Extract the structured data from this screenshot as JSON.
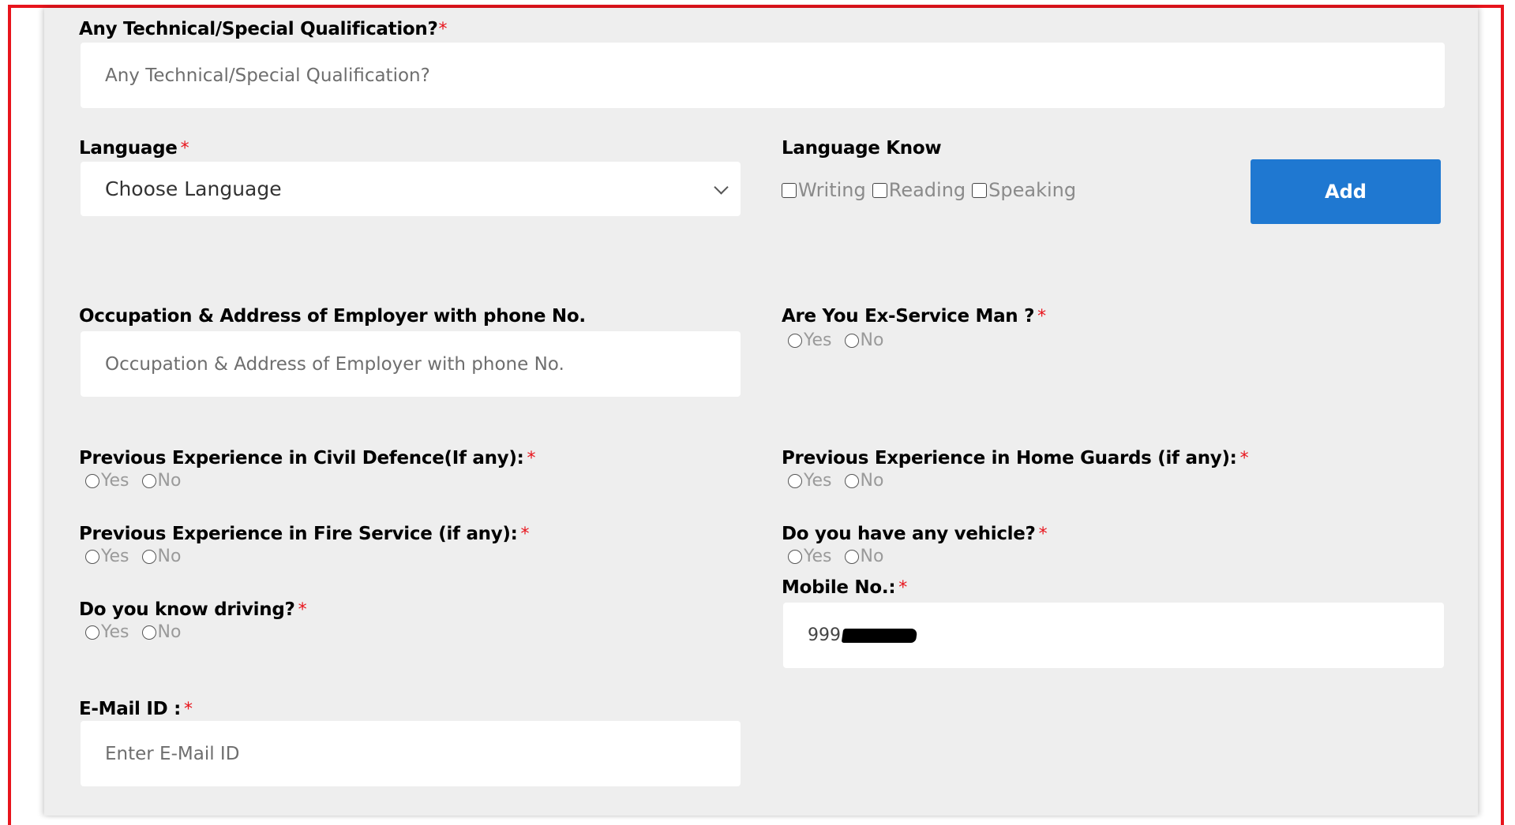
{
  "form": {
    "technical_qualification": {
      "label": "Any Technical/Special Qualification?",
      "required": "*",
      "placeholder": "Any Technical/Special Qualification?"
    },
    "language": {
      "label": "Language",
      "required": "*",
      "selected": "Choose Language"
    },
    "language_know": {
      "label": "Language Know",
      "options": [
        "Writing",
        "Reading",
        "Speaking"
      ],
      "add_button": "Add"
    },
    "occupation": {
      "label": "Occupation & Address of Employer with phone No.",
      "placeholder": "Occupation & Address of Employer with phone No."
    },
    "ex_service_man": {
      "label": "Are You Ex-Service Man ?",
      "required": "*",
      "options": [
        "Yes",
        "No"
      ]
    },
    "civil_defence": {
      "label": "Previous Experience in Civil Defence(If any):",
      "required": "*",
      "options": [
        "Yes",
        "No"
      ]
    },
    "home_guards": {
      "label": "Previous Experience in Home Guards (if any):",
      "required": "*",
      "options": [
        "Yes",
        "No"
      ]
    },
    "fire_service": {
      "label": "Previous Experience in Fire Service (if any):",
      "required": "*",
      "options": [
        "Yes",
        "No"
      ]
    },
    "vehicle": {
      "label": "Do you have any vehicle?",
      "required": "*",
      "options": [
        "Yes",
        "No"
      ]
    },
    "mobile": {
      "label": "Mobile No.:",
      "required": "*",
      "value": "999"
    },
    "driving": {
      "label": "Do you know driving?",
      "required": "*",
      "options": [
        "Yes",
        "No"
      ]
    },
    "email": {
      "label": "E-Mail ID :",
      "required": "*",
      "placeholder": "Enter E-Mail ID"
    }
  },
  "colors": {
    "accent": "#1f78d1",
    "required": "#e8141c",
    "panel_bg": "#eeeeee",
    "frame": "#e8141c"
  }
}
